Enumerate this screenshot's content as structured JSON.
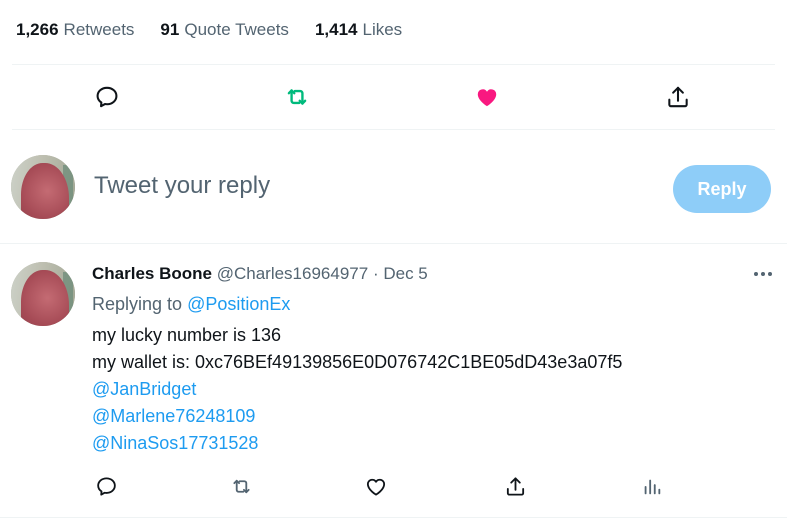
{
  "stats": {
    "retweets": {
      "count": "1,266",
      "label": "Retweets"
    },
    "quotes": {
      "count": "91",
      "label": "Quote Tweets"
    },
    "likes": {
      "count": "1,414",
      "label": "Likes"
    }
  },
  "colors": {
    "retweet_active": "#00ba7c",
    "like_active": "#f91880",
    "link": "#1d9bf0",
    "reply_button": "#8ecdf8",
    "muted_text": "#536471"
  },
  "main_actions": [
    {
      "icon": "reply-icon",
      "state": "default"
    },
    {
      "icon": "retweet-icon",
      "state": "active"
    },
    {
      "icon": "heart-filled-icon",
      "state": "active"
    },
    {
      "icon": "share-icon",
      "state": "default"
    }
  ],
  "compose": {
    "placeholder": "Tweet your reply",
    "button_label": "Reply"
  },
  "reply_tweet": {
    "name": "Charles Boone",
    "handle": "@Charles16964977",
    "separator": "·",
    "date": "Dec 5",
    "replying_prefix": "Replying to",
    "replying_to": "@PositionEx",
    "lines": [
      "my lucky number is 136",
      "my wallet is: 0xc76BEf49139856E0D076742C1BE05dD43e3a07f5"
    ],
    "mentions": [
      "@JanBridget",
      "@Marlene76248109",
      "@NinaSos17731528"
    ],
    "actions": [
      {
        "icon": "reply-icon"
      },
      {
        "icon": "retweet-icon"
      },
      {
        "icon": "heart-icon"
      },
      {
        "icon": "share-icon"
      },
      {
        "icon": "analytics-icon"
      }
    ]
  }
}
